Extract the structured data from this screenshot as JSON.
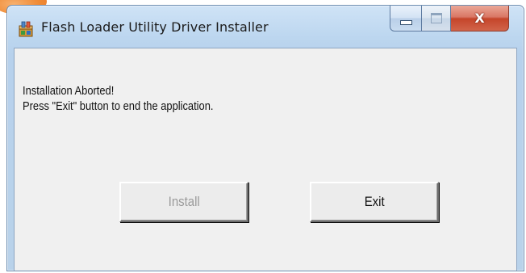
{
  "window": {
    "title": "Flash Loader Utility Driver Installer",
    "icon": "installer-package-icon",
    "controls": {
      "minimize": "minimize-icon",
      "maximize": "maximize-icon",
      "close": "X"
    }
  },
  "dialog": {
    "message_line1": "Installation Aborted!",
    "message_line2": "Press \"Exit\" button to end the application.",
    "install_label": "Install",
    "install_enabled": false,
    "exit_label": "Exit"
  },
  "colors": {
    "titlebar": "#bcd6ef",
    "client_background": "#f0f0f0",
    "close_button": "#c5452a",
    "disabled_text": "#9a9a9a"
  }
}
